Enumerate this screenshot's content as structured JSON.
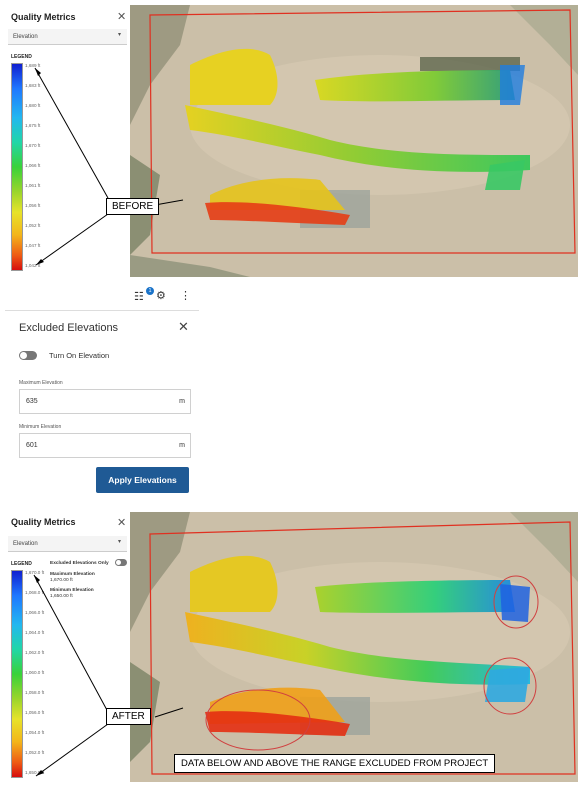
{
  "top_panel": {
    "title": "Quality Metrics",
    "close_icon": "close-icon",
    "dropdown_value": "Elevation",
    "legend_label": "LEGEND",
    "ticks": [
      "1,689 ft",
      "1,683 ft",
      "1,680 ft",
      "1,675 ft",
      "1,670 ft",
      "1,066 ft",
      "1,061 ft",
      "1,056 ft",
      "1,052 ft",
      "1,047 ft",
      "1,042 ft"
    ]
  },
  "bottom_panel": {
    "title": "Quality Metrics",
    "close_icon": "close-icon",
    "dropdown_value": "Elevation",
    "legend_label": "LEGEND",
    "excluded_only_label": "Excluded Elevations Only",
    "max_label": "Maximum Elevation",
    "max_value": "1,670.00 ft",
    "min_label": "Minimum Elevation",
    "min_value": "1,650.00 ft",
    "ticks": [
      "1,670.0 ft",
      "1,068.0 ft",
      "1,066.0 ft",
      "1,064.0 ft",
      "1,062.0 ft",
      "1,060.0 ft",
      "1,058.0 ft",
      "1,056.0 ft",
      "1,054.0 ft",
      "1,052.0 ft",
      "1,650.0 ft"
    ]
  },
  "callouts": {
    "before": "BEFORE",
    "after": "AFTER",
    "banner": "DATA BELOW AND ABOVE THE RANGE EXCLUDED FROM PROJECT"
  },
  "toolbar": {
    "filter_icon": "filter-sliders-icon",
    "badge_count": "1",
    "gear_icon": "gear-icon",
    "more_icon": "more-vertical-icon"
  },
  "excluded_elevations": {
    "title": "Excluded Elevations",
    "close_icon": "close-icon",
    "toggle_label": "Turn On Elevation",
    "max_label": "Maximum Elevation",
    "max_value": "635",
    "max_unit": "m",
    "min_label": "Minimum Elevation",
    "min_value": "601",
    "min_unit": "m",
    "apply_label": "Apply Elevations"
  },
  "colors": {
    "accent_button": "#1f5a95",
    "boundary": "#e03020",
    "annotation_circle": "#d04040"
  }
}
